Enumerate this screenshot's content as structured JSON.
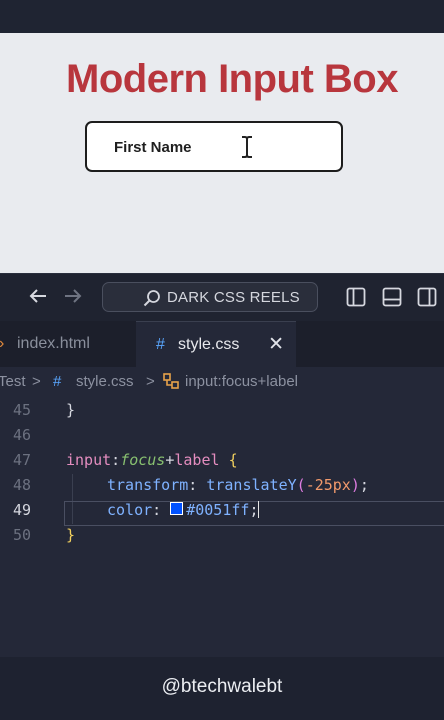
{
  "preview": {
    "title": "Modern Input Box",
    "input_label": "First Name"
  },
  "titlebar": {
    "search_text": "DARK CSS REELS"
  },
  "tabs": [
    {
      "label": "index.html",
      "icon": "chevron-right-icon",
      "active": false
    },
    {
      "label": "style.css",
      "icon": "#",
      "active": true
    }
  ],
  "breadcrumb": {
    "items": [
      "Test",
      ">",
      "#",
      "style.css",
      ">",
      "input:focus+label"
    ]
  },
  "editor": {
    "lines": [
      {
        "num": "45",
        "code": "}"
      },
      {
        "num": "46",
        "code": ""
      },
      {
        "num": "47",
        "code": "input:focus+label {"
      },
      {
        "num": "48",
        "code": "transform: translateY(-25px);"
      },
      {
        "num": "49",
        "code": "color: #0051ff;"
      },
      {
        "num": "50",
        "code": "}"
      }
    ],
    "tokens": {
      "l45_brace": "}",
      "l47_sel": "input",
      "l47_colon": ":",
      "l47_pseudo": "focus",
      "l47_plus": "+",
      "l47_label": "label",
      "l47_brace": "{",
      "l48_prop": "transform",
      "l48_colon": ": ",
      "l48_func": "translateY",
      "l48_open": "(",
      "l48_num": "-25px",
      "l48_close": ")",
      "l48_semi": ";",
      "l49_prop": "color",
      "l49_colon": ": ",
      "l49_val": "#0051ff",
      "l49_semi": ";",
      "l50_brace": "}"
    },
    "swatch_color": "#0051ff"
  },
  "watermark": "@btechwalebt"
}
